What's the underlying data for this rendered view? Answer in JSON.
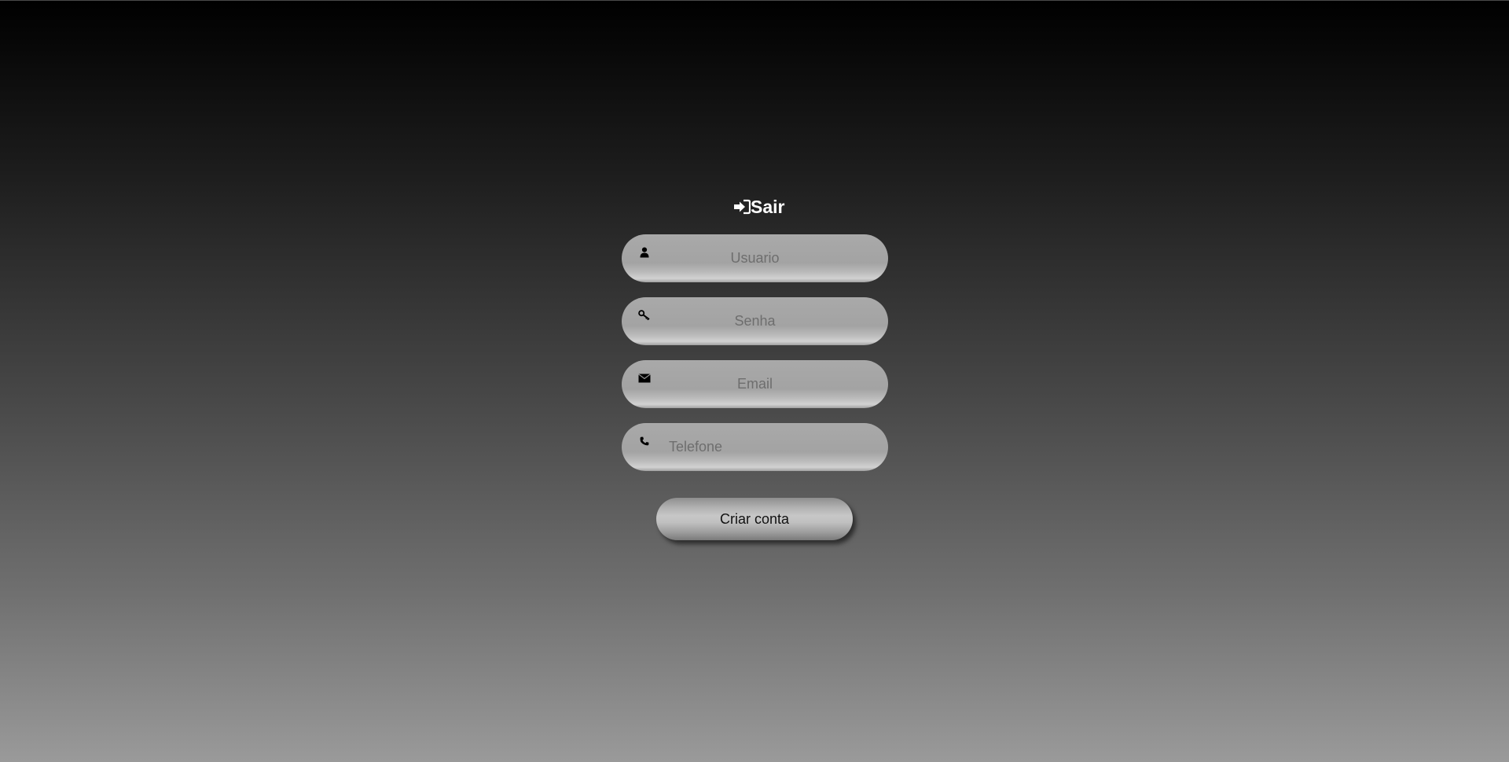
{
  "header": {
    "title": "Sair"
  },
  "form": {
    "username": {
      "placeholder": "Usuario",
      "value": ""
    },
    "password": {
      "placeholder": "Senha",
      "value": ""
    },
    "email": {
      "placeholder": "Email",
      "value": ""
    },
    "phone": {
      "placeholder": "Telefone",
      "value": ""
    },
    "submit_label": "Criar conta"
  },
  "icons": {
    "title": "sign-in-icon",
    "username": "user-icon",
    "password": "key-icon",
    "email": "envelope-icon",
    "phone": "phone-icon"
  },
  "colors": {
    "title_text": "#ffffff",
    "field_bg": "#a9a9a9",
    "placeholder": "#6e6e6e",
    "button_text": "#111111"
  }
}
